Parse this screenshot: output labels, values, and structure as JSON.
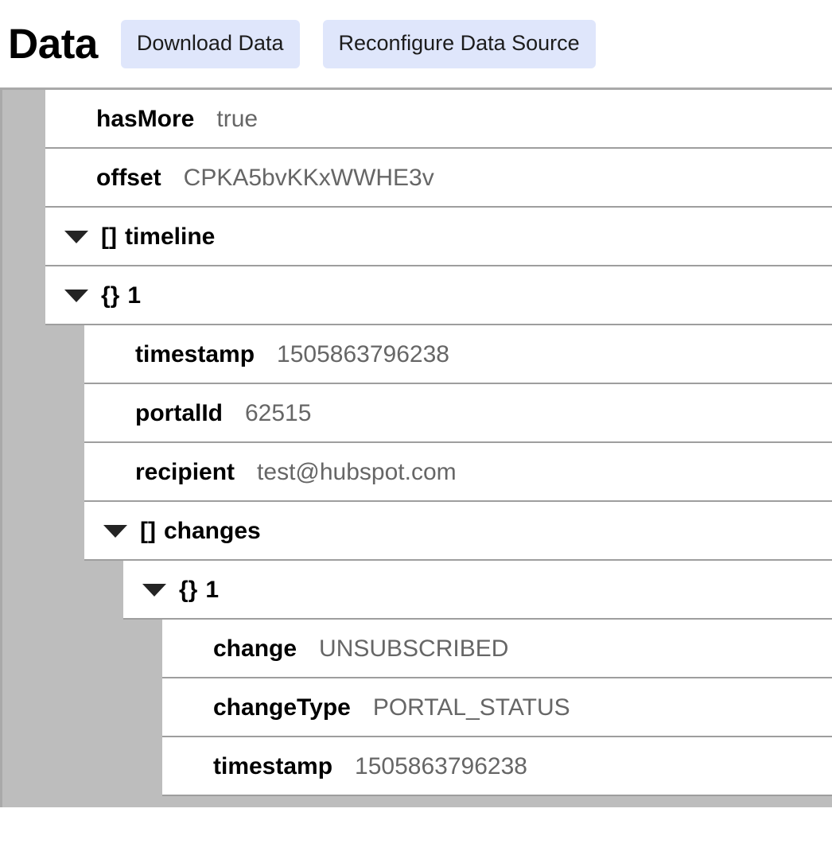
{
  "header": {
    "title": "Data",
    "buttons": [
      {
        "label": "Download Data",
        "name": "download-data-button"
      },
      {
        "label": "Reconfigure Data Source",
        "name": "reconfigure-data-source-button"
      }
    ]
  },
  "colors": {
    "button_background": "#dfe6fb",
    "button_text": "#1c1c1c",
    "gutter": "#bdbdbd",
    "row_background": "#ffffff",
    "row_border": "#9e9e9e",
    "key_text": "#000000",
    "value_text": "#666666",
    "caret": "#242424",
    "title_text": "#000000"
  },
  "icons": {
    "caret": "caret-down-icon",
    "array_marker": "[]",
    "object_marker": "{}"
  },
  "tree": {
    "rows": [
      {
        "level": 0,
        "expandable": false,
        "marker": "",
        "key": "hasMore",
        "value": "true",
        "name": "tree-row-hasMore"
      },
      {
        "level": 0,
        "expandable": false,
        "marker": "",
        "key": "offset",
        "value": "CPKA5bvKKxWWHE3v",
        "name": "tree-row-offset"
      },
      {
        "level": 0,
        "expandable": true,
        "marker": "[]",
        "key": "timeline",
        "value": "",
        "name": "tree-row-timeline"
      },
      {
        "level": 1,
        "expandable": true,
        "marker": "{}",
        "key": "1",
        "value": "",
        "name": "tree-row-timeline-0"
      },
      {
        "level": 2,
        "expandable": false,
        "marker": "",
        "key": "timestamp",
        "value": "1505863796238",
        "name": "tree-row-timestamp"
      },
      {
        "level": 2,
        "expandable": false,
        "marker": "",
        "key": "portalId",
        "value": "62515",
        "name": "tree-row-portalId"
      },
      {
        "level": 2,
        "expandable": false,
        "marker": "",
        "key": "recipient",
        "value": "test@hubspot.com",
        "name": "tree-row-recipient"
      },
      {
        "level": 2,
        "expandable": true,
        "marker": "[]",
        "key": "changes",
        "value": "",
        "name": "tree-row-changes"
      },
      {
        "level": 3,
        "expandable": true,
        "marker": "{}",
        "key": "1",
        "value": "",
        "name": "tree-row-changes-0"
      },
      {
        "level": 4,
        "expandable": false,
        "marker": "",
        "key": "change",
        "value": "UNSUBSCRIBED",
        "name": "tree-row-change"
      },
      {
        "level": 4,
        "expandable": false,
        "marker": "",
        "key": "changeType",
        "value": "PORTAL_STATUS",
        "name": "tree-row-changeType"
      },
      {
        "level": 4,
        "expandable": false,
        "marker": "",
        "key": "timestamp",
        "value": "1505863796238",
        "name": "tree-row-changeTimestamp"
      }
    ]
  }
}
